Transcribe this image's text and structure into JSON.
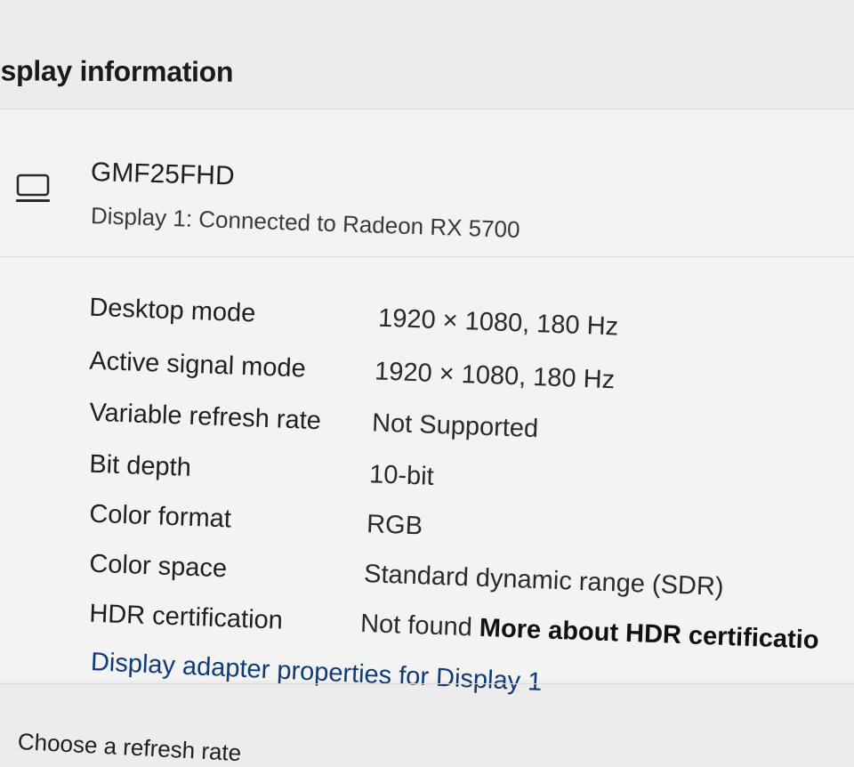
{
  "section": {
    "title": "isplay information"
  },
  "monitor": {
    "name": "GMF25FHD",
    "subtitle": "Display 1: Connected to Radeon RX 5700",
    "icon": "monitor-icon"
  },
  "info": {
    "desktop_mode": {
      "label": "Desktop mode",
      "value": "1920 × 1080, 180 Hz"
    },
    "active_signal_mode": {
      "label": "Active signal mode",
      "value": "1920 × 1080, 180 Hz"
    },
    "variable_refresh_rate": {
      "label": "Variable refresh rate",
      "value": "Not Supported"
    },
    "bit_depth": {
      "label": "Bit depth",
      "value": "10-bit"
    },
    "color_format": {
      "label": "Color format",
      "value": "RGB"
    },
    "color_space": {
      "label": "Color space",
      "value": "Standard dynamic range (SDR)"
    },
    "hdr_certification": {
      "label": "HDR certification",
      "value": "Not found",
      "link": "More about HDR certificatio"
    }
  },
  "adapter_link": "Display adapter properties for Display 1",
  "refresh_section": {
    "label": "Choose a refresh rate"
  }
}
